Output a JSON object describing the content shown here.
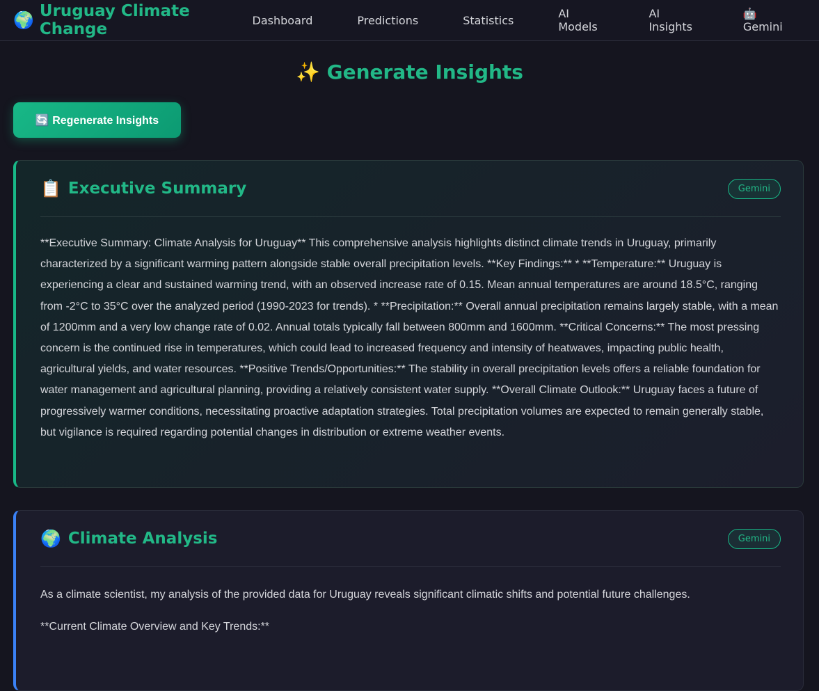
{
  "brand": {
    "icon": "🌍",
    "title": "Uruguay Climate Change"
  },
  "nav": [
    {
      "label": "Dashboard"
    },
    {
      "label": "Predictions"
    },
    {
      "label": "Statistics"
    },
    {
      "label": "AI Models"
    },
    {
      "label": "AI Insights"
    },
    {
      "label": "🤖 Gemini"
    }
  ],
  "page": {
    "title": "✨ Generate Insights",
    "regenerate_label": "🔄 Regenerate Insights"
  },
  "summary": {
    "icon": "📋",
    "title": "Executive Summary",
    "badge": "Gemini",
    "text": "**Executive Summary: Climate Analysis for Uruguay** This comprehensive analysis highlights distinct climate trends in Uruguay, primarily characterized by a significant warming pattern alongside stable overall precipitation levels. **Key Findings:** * **Temperature:** Uruguay is experiencing a clear and sustained warming trend, with an observed increase rate of 0.15. Mean annual temperatures are around 18.5°C, ranging from -2°C to 35°C over the analyzed period (1990-2023 for trends). * **Precipitation:** Overall annual precipitation remains largely stable, with a mean of 1200mm and a very low change rate of 0.02. Annual totals typically fall between 800mm and 1600mm. **Critical Concerns:** The most pressing concern is the continued rise in temperatures, which could lead to increased frequency and intensity of heatwaves, impacting public health, agricultural yields, and water resources. **Positive Trends/Opportunities:** The stability in overall precipitation levels offers a reliable foundation for water management and agricultural planning, providing a relatively consistent water supply. **Overall Climate Outlook:** Uruguay faces a future of progressively warmer conditions, necessitating proactive adaptation strategies. Total precipitation volumes are expected to remain generally stable, but vigilance is required regarding potential changes in distribution or extreme weather events."
  },
  "analysis": {
    "icon": "🌍",
    "title": "Climate Analysis",
    "badge": "Gemini",
    "paragraphs": [
      "As a climate scientist, my analysis of the provided data for Uruguay reveals significant climatic shifts and potential future challenges.",
      "**Current Climate Overview and Key Trends:**"
    ]
  }
}
